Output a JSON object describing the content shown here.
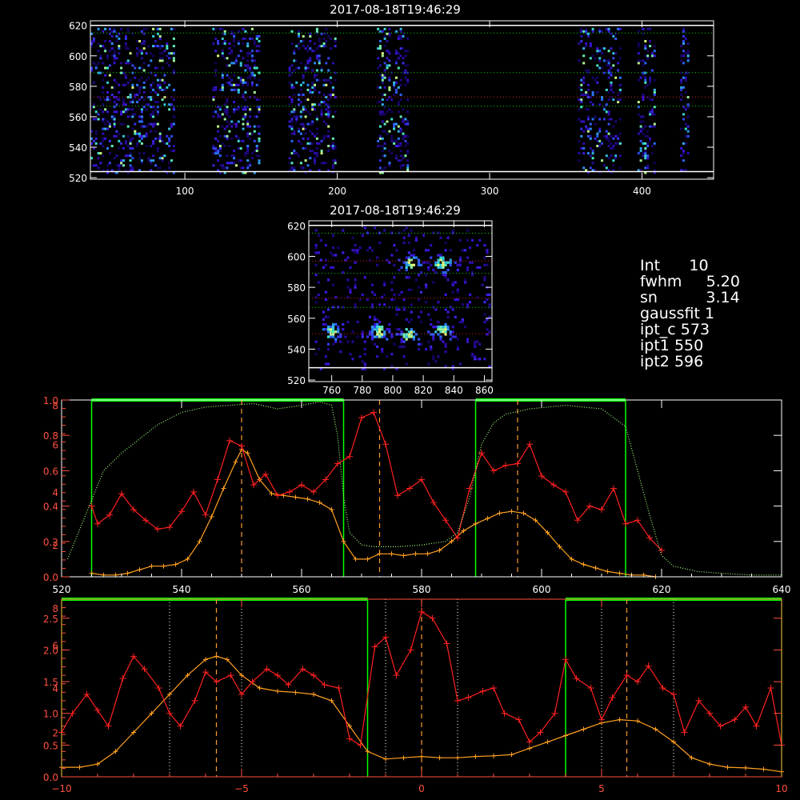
{
  "colors": {
    "background": "#000000",
    "frame": "#ffffff",
    "limit_line": "#00ff00",
    "series_red": "#ff2020",
    "series_orange": "#ffa020",
    "profile_dotted": "#a0ff80",
    "axis_red": "#ff5040",
    "center_marker": "#ff9a30",
    "guide_dotted_green": "#00e000",
    "guide_dotted_red": "#d02020"
  },
  "info_panel": {
    "int": {
      "label": "Int",
      "value": "10"
    },
    "fwhm": {
      "label": "fwhm",
      "value": "5.20"
    },
    "sn": {
      "label": "sn",
      "value": "3.14"
    },
    "gaussfit": {
      "label": "gaussfit",
      "value": "1"
    },
    "ipt_c": {
      "label": "ipt_c",
      "value": "573"
    },
    "ipt1": {
      "label": "ipt1",
      "value": "550"
    },
    "ipt2": {
      "label": "ipt2",
      "value": "596"
    }
  },
  "chart_data": [
    {
      "type": "heatmap",
      "title": "2017-08-18T19:46:29",
      "xlabel": "",
      "ylabel": "",
      "xlim": [
        38,
        447
      ],
      "ylim": [
        519,
        623
      ],
      "x_ticks": [
        "100",
        "200",
        "300",
        "400"
      ],
      "y_ticks": [
        "520",
        "540",
        "560",
        "580",
        "600",
        "620"
      ],
      "column_bands": [
        [
          38,
          92
        ],
        [
          118,
          148
        ],
        [
          168,
          198
        ],
        [
          226,
          246
        ],
        [
          358,
          386
        ],
        [
          397,
          408
        ],
        [
          425,
          430
        ]
      ],
      "solid_lines_y": [
        524,
        620
      ],
      "dotted_green_y": [
        567,
        589,
        615
      ],
      "dotted_red_y": [
        573
      ]
    },
    {
      "type": "heatmap",
      "title": "2017-08-18T19:46:29",
      "xlabel": "",
      "ylabel": "",
      "xlim": [
        745,
        865
      ],
      "ylim": [
        519,
        623
      ],
      "x_ticks": [
        "760",
        "780",
        "800",
        "820",
        "840",
        "860"
      ],
      "y_ticks": [
        "520",
        "540",
        "560",
        "580",
        "600",
        "620"
      ],
      "solid_lines_y": [
        528,
        620
      ],
      "dotted_green_y": [
        567,
        589,
        615
      ],
      "dotted_red_y": [
        550,
        573,
        597
      ]
    },
    {
      "type": "line",
      "title": "",
      "xlabel": "",
      "ylabel": "",
      "xlim": [
        520,
        640
      ],
      "x_ticks": [
        "520",
        "540",
        "560",
        "580",
        "600",
        "620",
        "640"
      ],
      "y_ticks_left_orange": [
        "0.0",
        "0.2",
        "0.4",
        "0.6",
        "0.8",
        "1.0"
      ],
      "y_ticks_left_red": [
        "2",
        "4",
        "6",
        "8"
      ],
      "limit_windows": [
        [
          525,
          567
        ],
        [
          589,
          614
        ]
      ],
      "center_markers": [
        550,
        573,
        596
      ],
      "series": [
        {
          "color": "orange",
          "x": [
            525,
            527,
            529,
            531,
            533,
            535,
            537,
            539,
            541,
            543,
            545,
            547,
            549,
            550,
            551,
            553,
            555,
            557,
            559,
            561,
            563,
            565,
            567,
            569,
            571,
            573,
            575,
            577,
            579,
            581,
            583,
            585,
            587,
            589,
            591,
            593,
            595,
            597,
            599,
            601,
            603,
            605,
            607,
            609,
            611,
            613,
            615,
            617,
            619
          ],
          "y": [
            0.02,
            0.01,
            0.01,
            0.02,
            0.04,
            0.06,
            0.06,
            0.07,
            0.1,
            0.2,
            0.34,
            0.5,
            0.65,
            0.72,
            0.7,
            0.55,
            0.47,
            0.46,
            0.45,
            0.44,
            0.42,
            0.38,
            0.2,
            0.1,
            0.1,
            0.13,
            0.13,
            0.12,
            0.13,
            0.13,
            0.15,
            0.2,
            0.26,
            0.3,
            0.33,
            0.36,
            0.37,
            0.36,
            0.32,
            0.25,
            0.17,
            0.1,
            0.07,
            0.05,
            0.03,
            0.02,
            0.01,
            0.01,
            0.0
          ]
        },
        {
          "color": "red",
          "x": [
            525,
            526,
            528,
            530,
            532,
            534,
            536,
            538,
            540,
            542,
            544,
            546,
            548,
            550,
            552,
            554,
            556,
            558,
            560,
            562,
            564,
            566,
            568,
            570,
            572,
            574,
            576,
            578,
            580,
            582,
            584,
            586,
            588,
            590,
            592,
            594,
            596,
            598,
            600,
            602,
            604,
            606,
            608,
            610,
            612,
            614,
            616,
            618,
            620
          ],
          "y": [
            0.4,
            0.3,
            0.35,
            0.47,
            0.38,
            0.32,
            0.27,
            0.28,
            0.37,
            0.48,
            0.35,
            0.55,
            0.77,
            0.74,
            0.52,
            0.58,
            0.46,
            0.48,
            0.52,
            0.48,
            0.55,
            0.64,
            0.68,
            0.9,
            0.93,
            0.75,
            0.46,
            0.5,
            0.55,
            0.42,
            0.32,
            0.22,
            0.5,
            0.7,
            0.6,
            0.63,
            0.64,
            0.75,
            0.57,
            0.52,
            0.48,
            0.32,
            0.4,
            0.38,
            0.5,
            0.3,
            0.32,
            0.22,
            0.15
          ]
        },
        {
          "color": "dotted",
          "x": [
            521,
            524,
            527,
            530,
            533,
            536,
            540,
            544,
            548,
            552,
            556,
            560,
            563,
            565,
            566,
            567,
            568,
            570,
            572,
            576,
            580,
            584,
            586,
            588,
            590,
            592,
            594,
            598,
            604,
            610,
            614,
            616,
            618,
            620,
            622,
            626,
            630,
            635,
            640
          ],
          "y": [
            0.1,
            0.35,
            0.6,
            0.7,
            0.78,
            0.86,
            0.93,
            0.96,
            0.97,
            0.98,
            0.95,
            0.97,
            0.99,
            0.97,
            0.8,
            0.45,
            0.25,
            0.18,
            0.17,
            0.17,
            0.18,
            0.2,
            0.25,
            0.45,
            0.75,
            0.87,
            0.92,
            0.95,
            0.97,
            0.95,
            0.85,
            0.6,
            0.35,
            0.12,
            0.06,
            0.03,
            0.02,
            0.01,
            0.01
          ]
        }
      ]
    },
    {
      "type": "line",
      "title": "",
      "xlabel": "",
      "ylabel": "",
      "xlim": [
        -10,
        10
      ],
      "x_ticks": [
        "−10",
        "−5",
        "0",
        "5",
        "10"
      ],
      "y_ticks_left_orange": [
        "0.0",
        "0.5",
        "1.0",
        "1.5",
        "2.0",
        "2.5"
      ],
      "y_ticks_left_red": [
        "2",
        "4",
        "6",
        "8"
      ],
      "limit_windows": [
        [
          -10,
          -1.5
        ],
        [
          4,
          10
        ]
      ],
      "center_markers": [
        -5.7,
        0,
        5.7
      ],
      "dotted_markers": [
        -7,
        -5,
        -1,
        1,
        5,
        7
      ],
      "series": [
        {
          "color": "orange",
          "x": [
            -10,
            -9.5,
            -9,
            -8.5,
            -8,
            -7.5,
            -7,
            -6.5,
            -6,
            -5.7,
            -5.4,
            -5,
            -4.5,
            -4,
            -3.5,
            -3,
            -2.5,
            -2,
            -1.5,
            -1,
            -0.5,
            0,
            0.5,
            1,
            1.5,
            2,
            2.5,
            3,
            3.5,
            4,
            4.5,
            5,
            5.5,
            6,
            6.5,
            7,
            7.5,
            8,
            8.5,
            9,
            9.5,
            10
          ],
          "y": [
            0.15,
            0.15,
            0.2,
            0.4,
            0.7,
            1.0,
            1.3,
            1.6,
            1.85,
            1.9,
            1.85,
            1.6,
            1.4,
            1.35,
            1.33,
            1.3,
            1.2,
            0.8,
            0.4,
            0.28,
            0.3,
            0.32,
            0.3,
            0.3,
            0.32,
            0.33,
            0.35,
            0.45,
            0.55,
            0.65,
            0.75,
            0.85,
            0.9,
            0.88,
            0.75,
            0.55,
            0.3,
            0.2,
            0.15,
            0.14,
            0.12,
            0.08
          ]
        },
        {
          "color": "red",
          "x": [
            -10,
            -9.7,
            -9.3,
            -9,
            -8.7,
            -8.3,
            -8,
            -7.7,
            -7.3,
            -7,
            -6.7,
            -6.3,
            -6,
            -5.7,
            -5.3,
            -5,
            -4.7,
            -4.3,
            -4,
            -3.7,
            -3.3,
            -3,
            -2.7,
            -2.3,
            -2,
            -1.7,
            -1.3,
            -1,
            -0.7,
            -0.3,
            0,
            0.3,
            0.7,
            1,
            1.3,
            1.7,
            2,
            2.3,
            2.7,
            3,
            3.3,
            3.7,
            4,
            4.3,
            4.7,
            5,
            5.3,
            5.7,
            6,
            6.3,
            6.7,
            7,
            7.3,
            7.7,
            8,
            8.3,
            8.7,
            9,
            9.3,
            9.7,
            10
          ],
          "y": [
            0.7,
            1.0,
            1.3,
            1.05,
            0.8,
            1.55,
            1.9,
            1.7,
            1.4,
            1.0,
            0.8,
            1.2,
            1.65,
            1.5,
            1.6,
            1.3,
            1.5,
            1.7,
            1.6,
            1.45,
            1.7,
            1.6,
            1.45,
            1.4,
            0.6,
            0.5,
            2.05,
            2.2,
            1.6,
            2.0,
            2.6,
            2.5,
            2.1,
            1.2,
            1.25,
            1.35,
            1.4,
            1.0,
            0.9,
            0.55,
            0.7,
            1.0,
            1.85,
            1.55,
            1.4,
            0.9,
            1.25,
            1.6,
            1.5,
            1.75,
            1.4,
            1.3,
            0.7,
            1.2,
            1.0,
            0.8,
            0.9,
            1.1,
            0.8,
            1.4,
            0.5
          ]
        }
      ]
    }
  ]
}
